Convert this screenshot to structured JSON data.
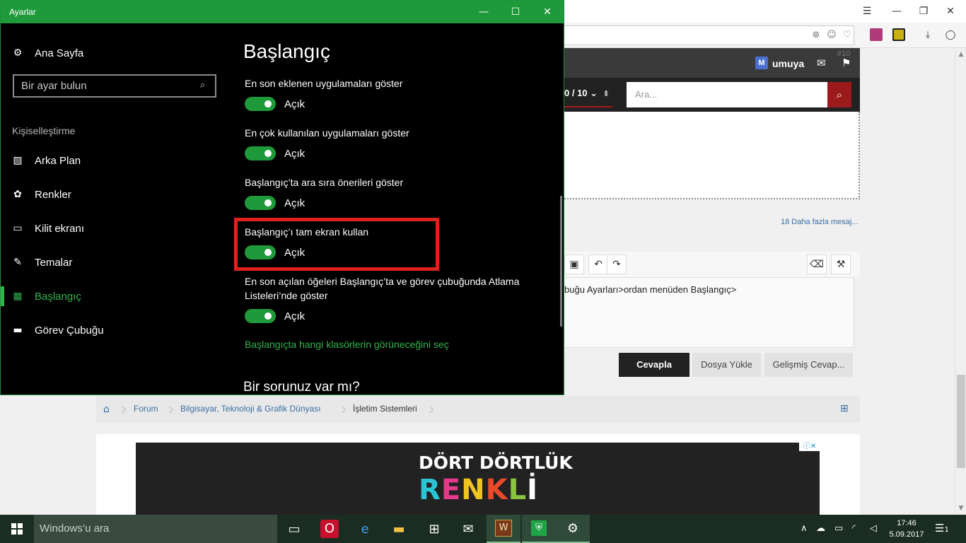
{
  "settings": {
    "window_title": "Ayarlar",
    "home_label": "Ana Sayfa",
    "search_placeholder": "Bir ayar bulun",
    "section_label": "Kişiselleştirme",
    "nav_items": [
      {
        "label": "Arka Plan",
        "icon": "image-icon"
      },
      {
        "label": "Renkler",
        "icon": "palette-icon"
      },
      {
        "label": "Kilit ekranı",
        "icon": "lock-screen-icon"
      },
      {
        "label": "Temalar",
        "icon": "themes-icon"
      },
      {
        "label": "Başlangıç",
        "icon": "start-icon",
        "active": true
      },
      {
        "label": "Görev Çubuğu",
        "icon": "taskbar-icon"
      }
    ],
    "page_title": "Başlangıç",
    "options": [
      {
        "label": "En son eklenen uygulamaları göster",
        "state": "Açık"
      },
      {
        "label": "En çok kullanılan uygulamaları göster",
        "state": "Açık"
      },
      {
        "label": "Başlangıç’ta ara sıra önerileri göster",
        "state": "Açık"
      },
      {
        "label": "Başlangıç’ı tam ekran kullan",
        "state": "Açık"
      },
      {
        "label": "En son açılan öğeleri Başlangıç’ta ve görev çubuğunda Atlama Listeleri’nde göster",
        "state": "Açık"
      }
    ],
    "folders_link": "Başlangıçta hangi klasörlerin görüneceğini seç",
    "help_heading": "Bir sorunuz var mı?",
    "accent_color": "#1f9a3b",
    "highlight_color": "#e4201f"
  },
  "browser": {
    "user_name": "umuya",
    "post_number": "#10",
    "page_selector": "0 / 10",
    "forum_search_placeholder": "Ara...",
    "more_messages": "18 Daha fazla mesaj...",
    "editor_text": "buğu Ayarları>ordan menüden Başlangıç>",
    "buttons": {
      "reply": "Cevapla",
      "upload": "Dosya Yükle",
      "advanced": "Gelişmiş Cevap..."
    },
    "breadcrumb": [
      "Forum",
      "Bilgisayar, Teknoloji & Grafik Dünyası",
      "İşletim Sistemleri"
    ],
    "ad": {
      "line1": "DÖRT DÖRTLÜK",
      "line2": "RENKLİ"
    }
  },
  "taskbar": {
    "search_placeholder": "Windows’u ara",
    "time": "17:46",
    "date": "5.09.2017",
    "notification_count": "1"
  }
}
